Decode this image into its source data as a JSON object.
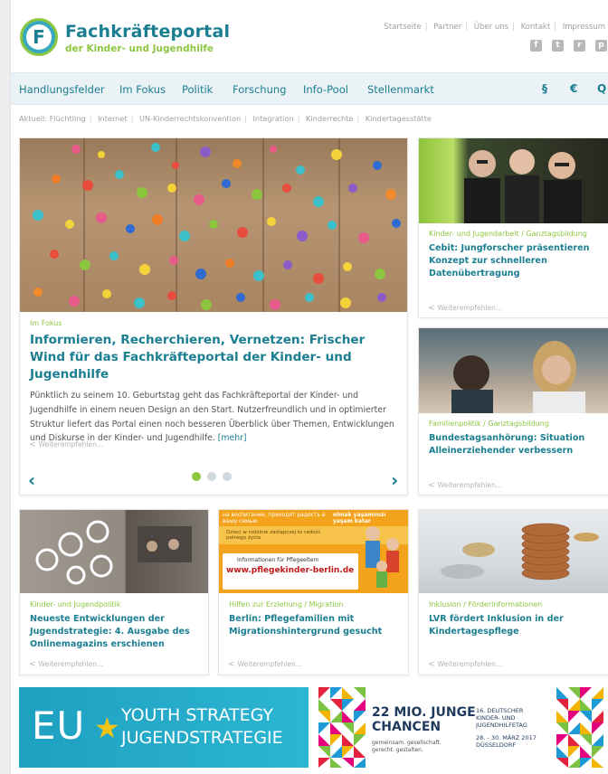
{
  "header": {
    "logo_letter": "F",
    "brand_title": "Fachkräfteportal",
    "brand_subtitle": "der Kinder- und Jugendhilfe",
    "util_links": [
      "Startseite",
      "Partner",
      "Über uns",
      "Kontakt",
      "Impressum"
    ],
    "social_icons": [
      {
        "name": "facebook-icon",
        "glyph": "f"
      },
      {
        "name": "twitter-icon",
        "glyph": "t"
      },
      {
        "name": "rss-icon",
        "glyph": "r"
      },
      {
        "name": "print-icon",
        "glyph": "p"
      }
    ]
  },
  "nav": {
    "items": [
      "Handlungsfelder",
      "Im Fokus",
      "Politik",
      "Forschung",
      "Info-Pool",
      "Stellenmarkt"
    ],
    "symbol_paragraph": "§",
    "symbol_euro": "€",
    "symbol_search": "Q"
  },
  "topics": {
    "label": "Aktuell:",
    "items": [
      "Flüchtling",
      "Internet",
      "UN-Kinderrechtskonvention",
      "Integration",
      "Kinderrechte",
      "Kindertagesstätte"
    ]
  },
  "hero": {
    "category": "Im Fokus",
    "title": "Informieren, Recherchieren, Vernetzen: Frischer Wind für das Fachkräfteportal der Kinder- und Jugendhilfe",
    "text": "Pünktlich zu seinem 10. Geburtstag geht das Fachkräfteportal der Kinder- und Jugendhilfe in einem neuen Design an den Start. Nutzerfreundlich und in optimierter Struktur liefert das Portal einen noch besseren Überblick über Themen, Entwicklungen und Diskurse in der Kinder- und Jugendhilfe.",
    "more": "[mehr]",
    "share": "Weiterempfehlen...",
    "prev": "‹",
    "next": "›",
    "dots": 3,
    "active_dot": 0
  },
  "side_cards": [
    {
      "category": "Kinder- und Jugendarbeit / Ganztagsbildung",
      "title": "Cebit: Jungforscher präsentieren Konzept zur schnelleren Datenübertragung",
      "share": "Weiterempfehlen..."
    },
    {
      "category": "Familienpolitik / Ganztagsbildung",
      "title": "Bundestagsanhörung: Situation Alleinerziehender verbessern",
      "share": "Weiterempfehlen..."
    }
  ],
  "bottom_cards": [
    {
      "category": "Kinder- und Jugendpolitik",
      "title": "Neueste Entwicklungen der Jugendstrategie: 4. Ausgabe des Onlinemagazins erschienen",
      "share": "Weiterempfehlen..."
    },
    {
      "category": "Hilfen zur Erziehung / Migration",
      "title": "Berlin: Pflegefamilien mit Migrationshintergrund gesucht",
      "share": "Weiterempfehlen...",
      "image_text": {
        "top": "на воспитание, приходят радость в вашу семью",
        "top_right": "olmak yaşamınızı yaşam katar",
        "stripe": "Dzieci w rodzinie zastępczej to radość pełnego życia",
        "info": "Informationen für Pflegeeltern",
        "url": "www.pflegekinder-berlin.de"
      }
    },
    {
      "category": "Inklusion / Förderinformationen",
      "title": "LVR fördert Inklusion in der Kindertagespflege",
      "share": "Weiterempfehlen..."
    }
  ],
  "banners": {
    "eu": {
      "letters": "EU",
      "star": "★",
      "line1": "YOUTH STRATEGY",
      "line2": "JUGENDSTRATEGIE"
    },
    "jugendhilfetag": {
      "main1": "22 MIO. JUNGE",
      "main2": "CHANCEN",
      "tag1": "gemeinsam. gesellschaft.",
      "tag2": "gerecht. gestalten.",
      "event1": "16. DEUTSCHER",
      "event2": "KINDER- UND",
      "event3": "JUGENDHILFETAG",
      "date": "28. - 30. MÄRZ 2017",
      "city": "DÜSSELDORF"
    }
  },
  "colors": {
    "brand_teal": "#1b7e91",
    "brand_green": "#8dc63f",
    "nav_bg": "#eaf2f6",
    "eu_blue": "#2cb6d2"
  }
}
